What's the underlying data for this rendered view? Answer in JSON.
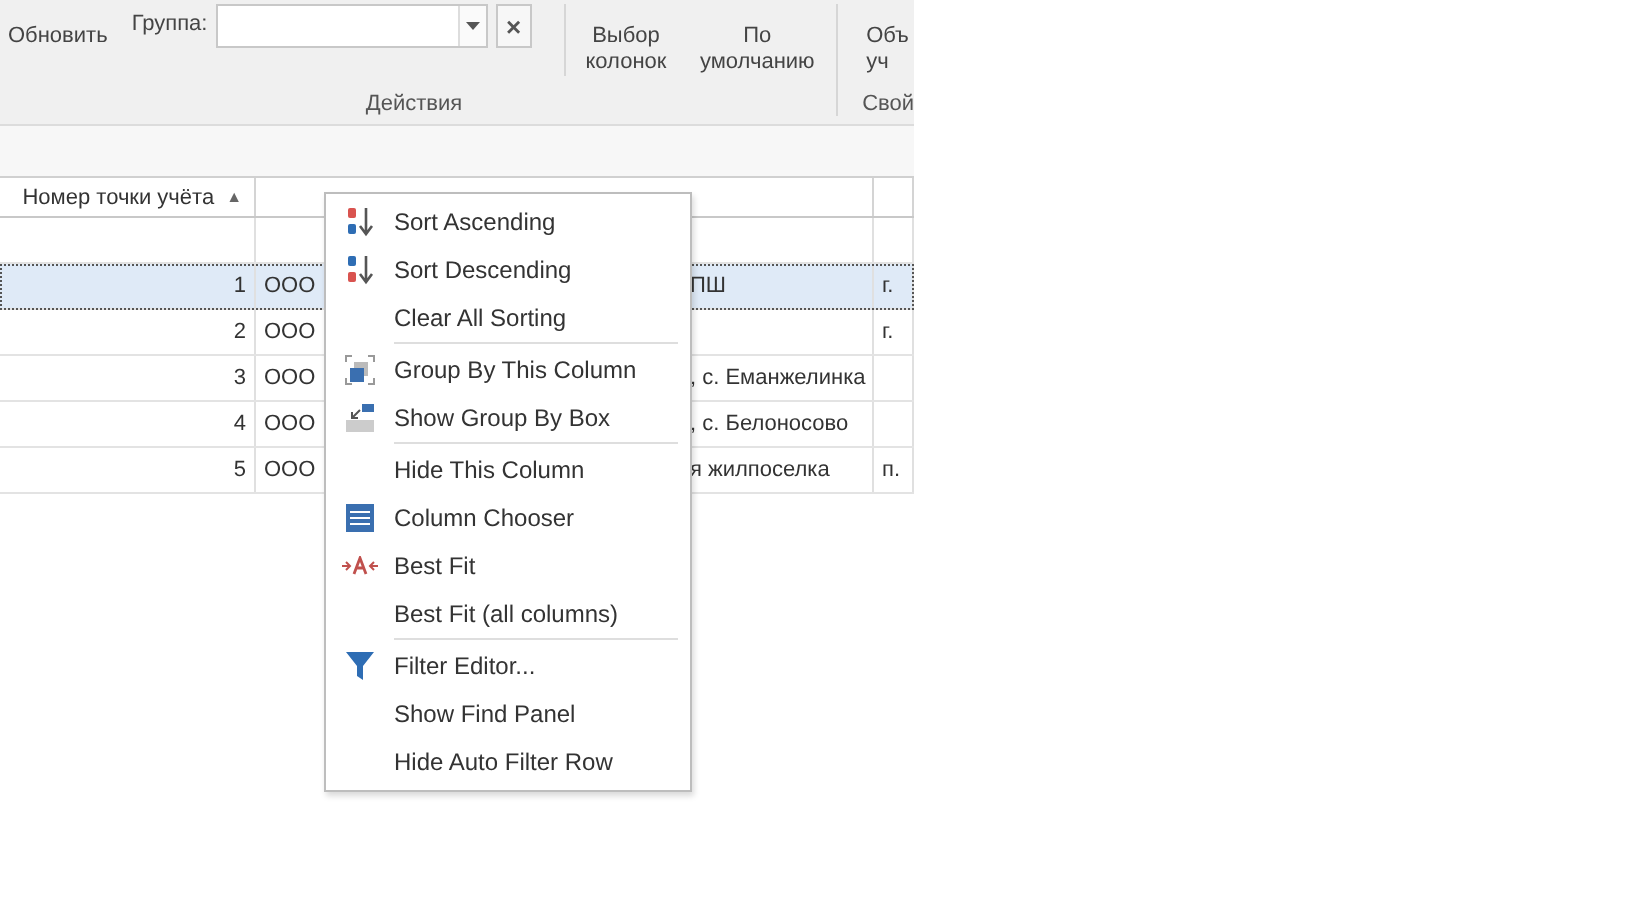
{
  "ribbon": {
    "refresh_button": "Обновить",
    "group_label": "Группа:",
    "clear_button": "×",
    "column_chooser_button": "Выбор колонок",
    "default_button": "По умолчанию",
    "objects_button": "Объ уч",
    "groups": [
      "Действия",
      "Свой"
    ]
  },
  "grid": {
    "columns": [
      {
        "label": "Номер точки учёта",
        "sort_arrow": "▲"
      },
      {},
      {}
    ],
    "rows": [
      {
        "number": "1",
        "name_start": "ООО",
        "name_end": "ПШ",
        "column_3": "г.",
        "selected": true
      },
      {
        "number": "2",
        "name_start": "ООО",
        "column_3": "г.",
        "selected": false
      },
      {
        "number": "3",
        "name_start": "ООО",
        "name_end": ", с. Еманжелинка",
        "selected": false
      },
      {
        "number": "4",
        "name_start": "ООО",
        "name_end": ", с. Белоносово",
        "selected": false
      },
      {
        "number": "5",
        "name_start": "ООО",
        "name_end": "я жилпоселка",
        "column_3": "п.",
        "selected": false
      }
    ]
  },
  "context_menu": [
    {
      "label": "Sort Ascending",
      "kind": "sort-asc"
    },
    {
      "label": "Sort Descending",
      "kind": "sort-desc"
    },
    {
      "label": "Clear All Sorting",
      "kind": "plain",
      "separator_after": true
    },
    {
      "label": "Group By This Column",
      "kind": "group"
    },
    {
      "label": "Show Group By Box",
      "kind": "groupbox",
      "separator_after": true
    },
    {
      "label": "Hide This Column",
      "kind": "plain"
    },
    {
      "label": "Column Chooser",
      "kind": "chooser"
    },
    {
      "label": "Best Fit",
      "kind": "bestfit"
    },
    {
      "label": "Best Fit (all columns)",
      "kind": "plain",
      "separator_after": true
    },
    {
      "label": "Filter Editor...",
      "kind": "filter"
    },
    {
      "label": "Show Find Panel",
      "kind": "plain"
    },
    {
      "label": "Hide Auto Filter Row",
      "kind": "plain"
    }
  ]
}
